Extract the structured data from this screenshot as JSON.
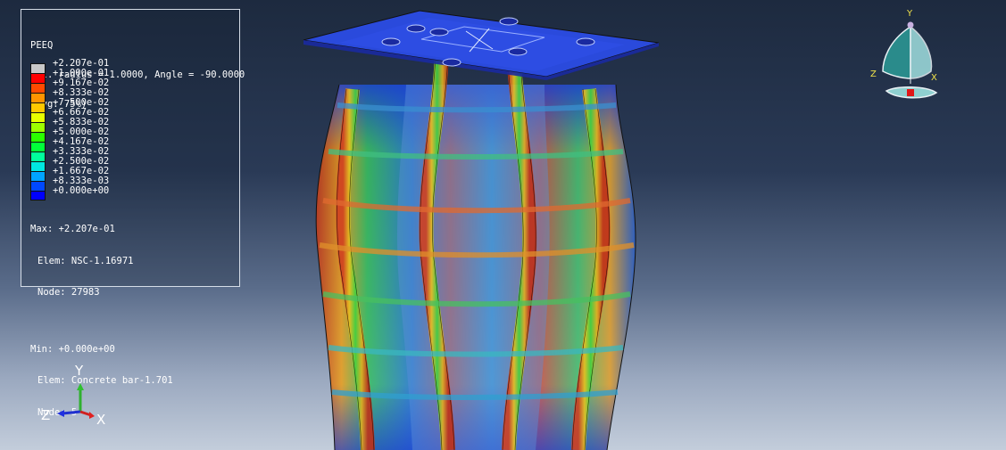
{
  "legend": {
    "header": [
      "PEEQ",
      "Rel. radius = 1.0000, Angle = -90.0000",
      "(Avg: 75%)"
    ],
    "entries": [
      {
        "label": "+2.207e-01",
        "color": "#c8c8c8"
      },
      {
        "label": "+1.000e-01",
        "color": "#ff0000"
      },
      {
        "label": "+9.167e-02",
        "color": "#ff4a00"
      },
      {
        "label": "+8.333e-02",
        "color": "#ff9400"
      },
      {
        "label": "+7.500e-02",
        "color": "#ffc800"
      },
      {
        "label": "+6.667e-02",
        "color": "#e8ff00"
      },
      {
        "label": "+5.833e-02",
        "color": "#9dff00"
      },
      {
        "label": "+5.000e-02",
        "color": "#2aff00"
      },
      {
        "label": "+4.167e-02",
        "color": "#00ff3a"
      },
      {
        "label": "+3.333e-02",
        "color": "#00ff9c"
      },
      {
        "label": "+2.500e-02",
        "color": "#00e8e0"
      },
      {
        "label": "+1.667e-02",
        "color": "#00a4ff"
      },
      {
        "label": "+8.333e-03",
        "color": "#0048ff"
      },
      {
        "label": "+0.000e+00",
        "color": "#0000ff"
      }
    ],
    "max": {
      "value": "Max: +2.207e-01",
      "elem": "Elem: NSC-1.16971",
      "node": "Node: 27983"
    },
    "min": {
      "value": "Min: +0.000e+00",
      "elem": "Elem: Concrete bar-1.701",
      "node": "Node: 5"
    }
  },
  "triad_small": {
    "y": "Y",
    "z": "Z",
    "x": "X"
  },
  "triad_view": {
    "y": "Y",
    "z": "Z",
    "x": "X"
  }
}
